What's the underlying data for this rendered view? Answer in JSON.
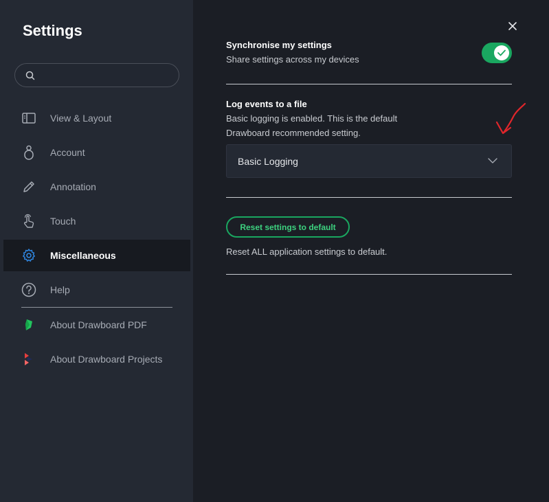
{
  "sidebar": {
    "title": "Settings",
    "search_placeholder": "",
    "items": [
      {
        "label": "View & Layout",
        "icon": "layout-icon"
      },
      {
        "label": "Account",
        "icon": "user-icon"
      },
      {
        "label": "Annotation",
        "icon": "pencil-icon"
      },
      {
        "label": "Touch",
        "icon": "touch-icon"
      },
      {
        "label": "Miscellaneous",
        "icon": "gear-icon",
        "active": true
      },
      {
        "label": "Help",
        "icon": "help-icon"
      },
      {
        "label": "About Drawboard PDF",
        "icon": "drawboard-pdf-logo-icon"
      },
      {
        "label": "About Drawboard Projects",
        "icon": "drawboard-projects-logo-icon"
      }
    ]
  },
  "main": {
    "sync": {
      "title": "Synchronise my settings",
      "description": "Share settings across my devices",
      "enabled": true
    },
    "logging": {
      "title": "Log events to a file",
      "description_line1": "Basic logging is enabled. This is the default",
      "description_line2": "Drawboard recommended setting.",
      "selected": "Basic Logging"
    },
    "reset": {
      "button_label": "Reset settings to default",
      "description": "Reset ALL application settings to default."
    }
  },
  "colors": {
    "accent": "#1aa760",
    "annotation_arrow": "#e0262b",
    "sidebar_bg": "#242933",
    "main_bg": "#1b1e25"
  }
}
